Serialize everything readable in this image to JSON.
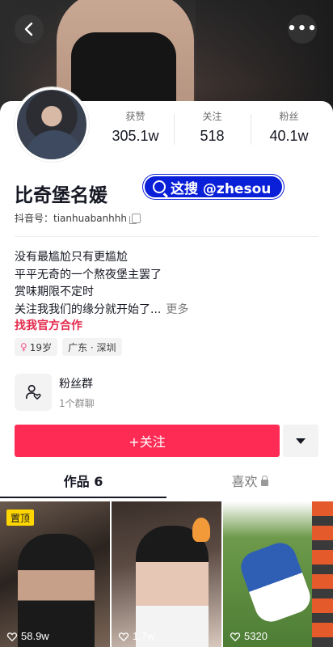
{
  "stats": [
    {
      "label": "获赞",
      "value": "305.1w"
    },
    {
      "label": "关注",
      "value": "518"
    },
    {
      "label": "粉丝",
      "value": "40.1w"
    }
  ],
  "profile": {
    "name": "比奇堡名媛",
    "search_tag": "这搜 @zhesou",
    "douyin_id_label": "抖音号：",
    "douyin_id": "tianhuabanhhh"
  },
  "bio": {
    "lines": [
      "没有最尴尬只有更尴尬",
      "平平无奇的一个熬夜堡主罢了",
      "赏味期限不定时",
      "关注我我们的缘分就开始了..."
    ],
    "more": "更多",
    "cooperate": "找我官方合作"
  },
  "chips": {
    "gender_symbol": "♀",
    "age": "19岁",
    "location": "广东 · 深圳"
  },
  "fan_group": {
    "title": "粉丝群",
    "count": "1个群聊"
  },
  "follow_button": "+关注",
  "tabs": {
    "works": "作品 6",
    "likes": "喜欢"
  },
  "videos": [
    {
      "pinned": "置顶",
      "likes": "58.9w"
    },
    {
      "likes": "1.7w"
    },
    {
      "likes": "5320"
    }
  ],
  "colors": {
    "accent": "#fe2c55",
    "cooperate": "#e4294b",
    "search_tag": "#0a1fd8",
    "pin_badge": "#ffd600"
  }
}
